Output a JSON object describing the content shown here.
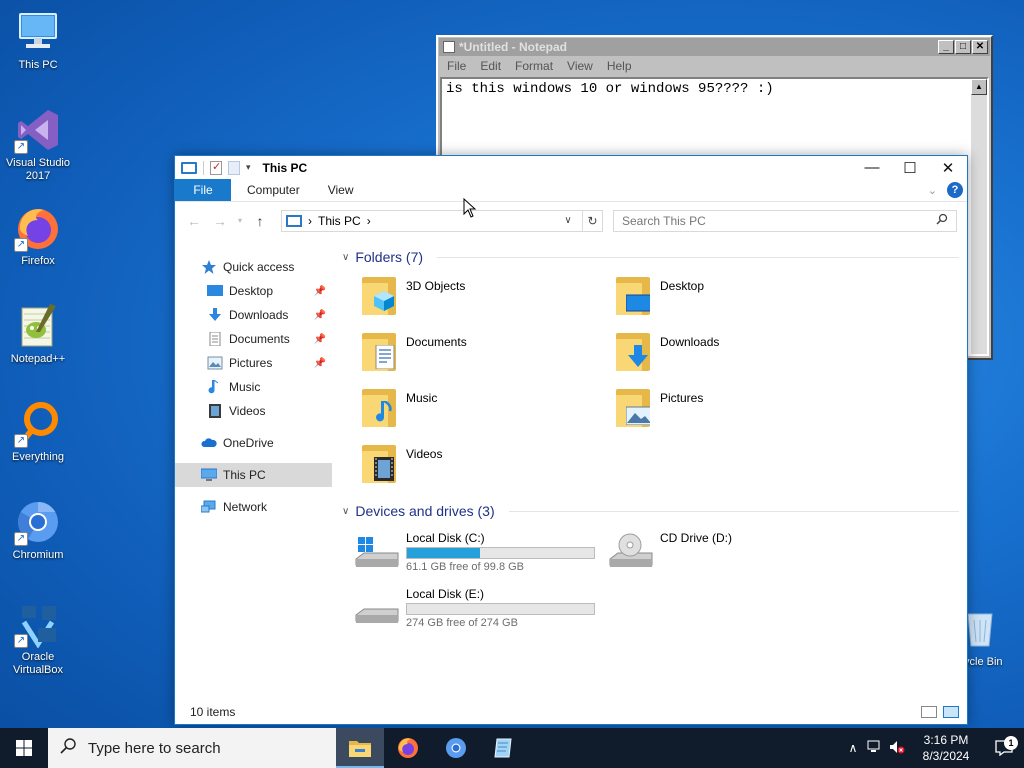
{
  "desktop": {
    "icons": [
      {
        "label": "This PC",
        "shortcut": false
      },
      {
        "label": "Visual Studio 2017",
        "shortcut": true
      },
      {
        "label": "Firefox",
        "shortcut": true
      },
      {
        "label": "Notepad++",
        "shortcut": false
      },
      {
        "label": "Everything",
        "shortcut": true
      },
      {
        "label": "Chromium",
        "shortcut": true
      },
      {
        "label": "Oracle VirtualBox",
        "shortcut": true
      }
    ],
    "recycle_bin_label": "ycle Bin"
  },
  "notepad": {
    "title": "*Untitled - Notepad",
    "menu": [
      "File",
      "Edit",
      "Format",
      "View",
      "Help"
    ],
    "text": "is this windows 10 or windows 95???? :)",
    "buttons": {
      "minimize": "_",
      "maximize": "□",
      "close": "✕"
    }
  },
  "explorer": {
    "title": "This PC",
    "tabs": {
      "file": "File",
      "computer": "Computer",
      "view": "View"
    },
    "help": "?",
    "address": {
      "location": "This PC",
      "separator": "›"
    },
    "search_placeholder": "Search This PC",
    "nav": {
      "quick_access": "Quick access",
      "pinned": [
        {
          "label": "Desktop"
        },
        {
          "label": "Downloads"
        },
        {
          "label": "Documents"
        },
        {
          "label": "Pictures"
        }
      ],
      "unpinned": [
        {
          "label": "Music"
        },
        {
          "label": "Videos"
        }
      ],
      "onedrive": "OneDrive",
      "this_pc": "This PC",
      "network": "Network"
    },
    "folders_header": "Folders (7)",
    "folders": [
      {
        "name": "3D Objects"
      },
      {
        "name": "Desktop"
      },
      {
        "name": "Documents"
      },
      {
        "name": "Downloads"
      },
      {
        "name": "Music"
      },
      {
        "name": "Pictures"
      },
      {
        "name": "Videos"
      }
    ],
    "drives_header": "Devices and drives (3)",
    "drives": [
      {
        "name": "Local Disk (C:)",
        "free_text": "61.1 GB free of 99.8 GB",
        "used_fraction": 0.388,
        "bar_color": "#26a0da"
      },
      {
        "name": "CD Drive (D:)",
        "free_text": "",
        "used_fraction": null
      },
      {
        "name": "Local Disk (E:)",
        "free_text": "274 GB free of 274 GB",
        "used_fraction": 0.0,
        "bar_color": "#26a0da"
      }
    ],
    "status": "10 items"
  },
  "taskbar": {
    "search_placeholder": "Type here to search",
    "apps": [
      "file-explorer",
      "firefox",
      "chromium",
      "notepad"
    ],
    "time": "3:16 PM",
    "date": "8/3/2024",
    "notification_count": "1"
  },
  "colors": {
    "accent": "#1979ca",
    "drive_bar": "#26a0da",
    "group_header": "#1e3287",
    "taskbar": "#101c2c"
  }
}
